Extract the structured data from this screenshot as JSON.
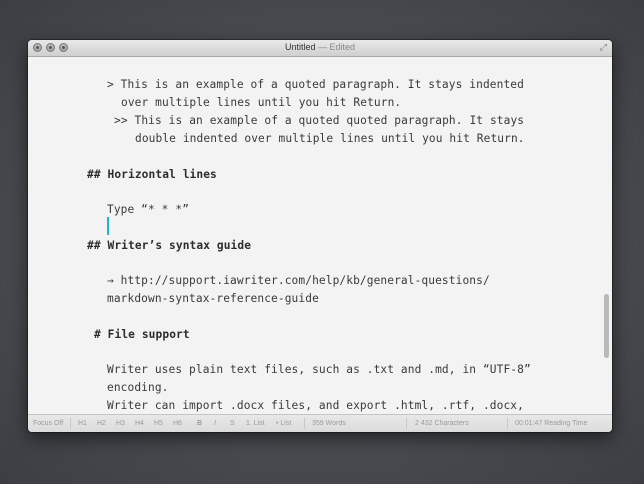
{
  "window": {
    "title": "Untitled",
    "title_status": "— Edited"
  },
  "editor": {
    "lines": [
      "> This is an example of a quoted paragraph. It stays indented",
      "over multiple lines until you hit Return.",
      ">> This is an example of a quoted quoted paragraph. It stays",
      "double indented over multiple lines until you hit Return.",
      "## Horizontal lines",
      "Type “* * *”",
      "## Writer’s syntax guide",
      "→ http://support.iawriter.com/help/kb/general-questions/",
      "markdown-syntax-reference-guide",
      "# File support",
      "Writer uses plain text files, such as .txt and .md, in “UTF-8”",
      "encoding.",
      "Writer can import .docx files, and export .html, .rtf, .docx,"
    ]
  },
  "statusbar": {
    "focus": "Focus Off",
    "headers": [
      "H1",
      "H2",
      "H3",
      "H4",
      "H5",
      "H6"
    ],
    "bold": "B",
    "italic": "I",
    "strike": "S",
    "numbered_list": "1. List",
    "bullet_list": "• List",
    "words": "359 Words",
    "characters": "2 432 Characters",
    "reading_time": "00:01:47 Reading Time"
  },
  "colors": {
    "cursor": "#20b5cf",
    "editor_bg": "#f3f3f3",
    "text": "#3a3a3a"
  }
}
